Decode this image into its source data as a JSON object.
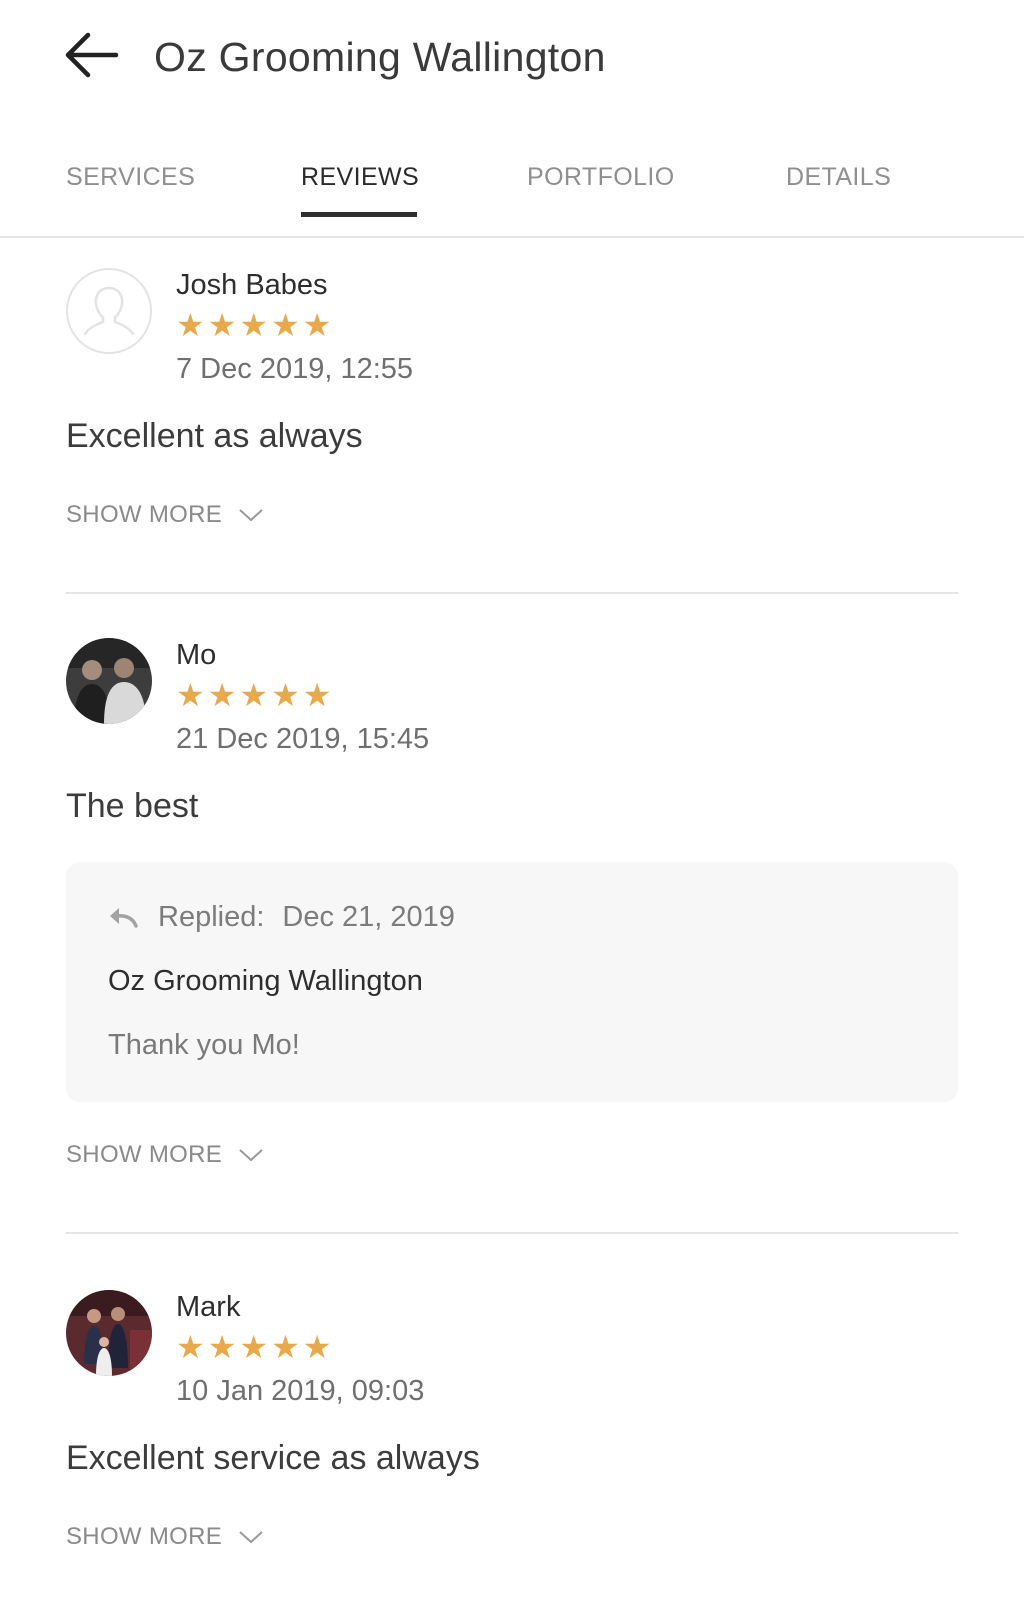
{
  "header": {
    "back_icon": "arrow-left-icon",
    "title": "Oz Grooming Wallington"
  },
  "tabs": [
    {
      "label": "SERVICES",
      "active": false
    },
    {
      "label": "REVIEWS",
      "active": true
    },
    {
      "label": "PORTFOLIO",
      "active": false
    },
    {
      "label": "DETAILS",
      "active": false
    }
  ],
  "colors": {
    "star": "#e8a94d",
    "tab_active": "#2b2b2b",
    "tab_inactive": "#8f8f8f",
    "reply_background": "#f7f7f7"
  },
  "reviews": [
    {
      "name": "Josh Babes",
      "rating": 5,
      "date": "7 Dec 2019, 12:55",
      "text": "Excellent as always",
      "show_more": "SHOW MORE",
      "avatar": "default-user-icon"
    },
    {
      "name": "Mo",
      "rating": 5,
      "date": "21 Dec 2019, 15:45",
      "text": "The best",
      "show_more": "SHOW MORE",
      "avatar": "user-photo",
      "reply": {
        "icon": "reply-icon",
        "label": "Replied:",
        "date": "Dec 21, 2019",
        "author": "Oz Grooming Wallington",
        "text": "Thank you Mo!"
      }
    },
    {
      "name": "Mark",
      "rating": 5,
      "date": "10 Jan 2019, 09:03",
      "text": "Excellent service as always",
      "show_more": "SHOW MORE",
      "avatar": "user-photo"
    }
  ]
}
